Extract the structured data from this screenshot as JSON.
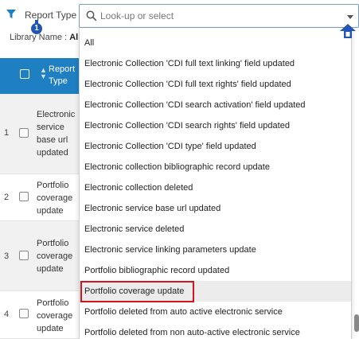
{
  "filter": {
    "report_type_label": "Report Type :",
    "library_name_label": "Library Name :",
    "library_name_value": "Al",
    "badge_number": "1"
  },
  "dropdown": {
    "placeholder": "Look-up or select",
    "value": "",
    "options": [
      "All",
      "Electronic Collection 'CDI full text linking' field updated",
      "Electronic Collection 'CDI full text rights' field updated",
      "Electronic Collection 'CDI search activation' field updated",
      "Electronic Collection 'CDI search rights' field updated",
      "Electronic Collection 'CDI type' field updated",
      "Electronic collection bibliographic record update",
      "Electronic collection deleted",
      "Electronic service base url updated",
      "Electronic service deleted",
      "Electronic service linking parameters update",
      "Portfolio bibliographic record updated",
      "Portfolio coverage update",
      "Portfolio deleted from auto active electronic service",
      "Portfolio deleted from non auto-active electronic service"
    ],
    "highlighted_index": 12
  },
  "table": {
    "header": "Report Type",
    "rows": [
      {
        "num": "1",
        "lines": [
          "Electronic",
          "service",
          "base url",
          "updated"
        ]
      },
      {
        "num": "2",
        "lines": [
          "Portfolio",
          "coverage",
          "update"
        ]
      },
      {
        "num": "3",
        "lines": [
          "Portfolio",
          "coverage",
          "update"
        ]
      },
      {
        "num": "4",
        "lines": [
          "Portfolio",
          "coverage",
          "update"
        ]
      }
    ]
  },
  "colors": {
    "accent": "#1e7fc2",
    "badge": "#2054b5",
    "highlight_border": "#d4151b"
  }
}
